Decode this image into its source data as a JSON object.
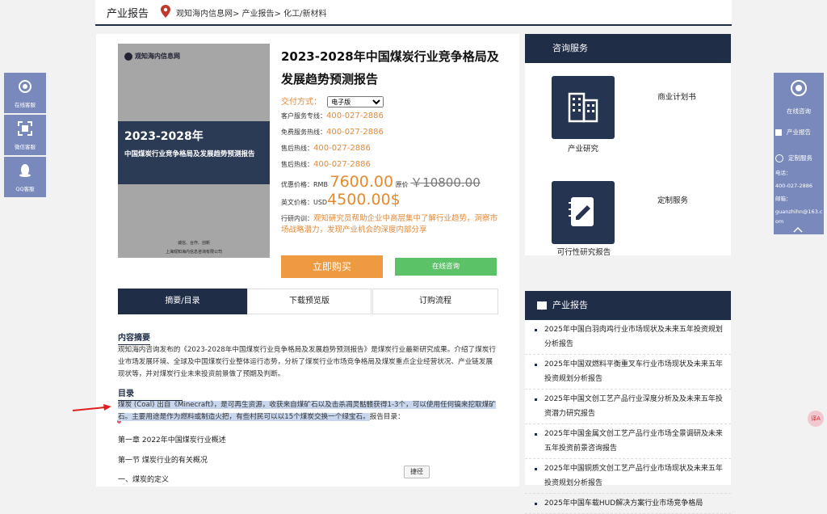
{
  "topbar": {
    "title": "产业报告",
    "breadcrumb": "观知海内信息网> 产业报告> 化工/新材料"
  },
  "cover": {
    "logo": "观知海内信息网",
    "year": "2023-2028年",
    "title": "中国煤炭行业竞争格局及发展趋势预测报告",
    "slogan": "诚信、合作、创新",
    "company": "上海观知海内信息咨询有限公司"
  },
  "product": {
    "title": "2023-2028年中国煤炭行业竞争格局及发展趋势预测报告",
    "delivery_label": "交付方式：",
    "delivery_value": "电子版",
    "hotlines": [
      {
        "label": "客户服务专线：",
        "phone": "400-027-2886"
      },
      {
        "label": "免费服务热线：",
        "phone": "400-027-2886"
      },
      {
        "label": "售后热线：",
        "phone": "400-027-2886"
      },
      {
        "label": "售后热线：",
        "phone": "400-027-2886"
      }
    ],
    "price_label": "优惠价格：",
    "price_currency": "RMB",
    "price_value": "7600.00",
    "orig_label": "原价",
    "orig_value": "￥10800.00",
    "en_label": "英文价格：",
    "en_currency": "USD",
    "en_value": "4500.00$",
    "train_label": "行研内训：",
    "train_text": "观知研究员帮助企业中高层集中了解行业趋势，洞察市场战略潜力，发现产业机会的深度内部分享",
    "buy_label": "立即购买",
    "chat_label": "在线咨询"
  },
  "tabs": [
    "摘要/目录",
    "下载预览版",
    "订购流程"
  ],
  "summary": {
    "heading": "内容摘要",
    "text": "观知海内咨询发布的《2023-2028年中国煤炭行业竞争格局及发展趋势预测报告》是煤炭行业最新研究成果。介绍了煤炭行业市场发展环境、全球及中国煤炭行业整体运行态势，分析了煤炭行业市场竞争格局及煤炭重点企业经营状况、产业链发展现状等，并对煤炭行业未来投资前景做了预期及判断。"
  },
  "toc": {
    "heading": "目录",
    "highlighted": "煤炭 (Coal) 出自《Minecraft》，是可再生资源，收获来自煤矿石以及击杀凋灵骷髅获得1-3个，可以使用任何镐来挖取煤矿石。主要用途是作为燃料或制造火把，有些村民可以以15个煤炭交换一个绿宝石。",
    "tail": "报告目录：",
    "chapter1": "第一章 2022年中国煤炭行业概述",
    "section1": "第一节 煤炭行业的有关概况",
    "item1": "一、煤炭的定义"
  },
  "consult": {
    "header": "咨询服务",
    "items": [
      "产业研究",
      "商业计划书",
      "可行性研究报告",
      "定制服务"
    ]
  },
  "reports": {
    "header": "产业报告",
    "items": [
      "2025年中国白羽肉鸡行业市场现状及未来五年投资规划分析报告",
      "2025年中国双燃料平衡重叉车行业市场现状及未来五年投资规划分析报告",
      "2025年中国文创工艺产品行业深度分析及及未来五年投资潜力研究报告",
      "2025年中国金属文创工艺产品行业市场全景调研及未来五年投资前景咨询报告",
      "2025年中国铜质文创工艺产品行业市场现状及未来五年投资规划分析报告",
      "2025年中国车载HUD解决方案行业市场竞争格局"
    ]
  },
  "left_float": [
    "在线客服",
    "微信客服",
    "QQ客服"
  ],
  "right_float": {
    "online": "在线咨询",
    "report": "产业报告",
    "custom": "定制服务",
    "phone_label": "电话：",
    "phone": "400-027-2886",
    "email_label": "邮箱：",
    "email": "guanzhihn@163.com"
  },
  "screenshot_label": "捷径",
  "translate_label": "译A",
  "colors": {
    "navy": "#1f2d47",
    "orange": "#e58a2e",
    "green": "#5cc268",
    "float": "#7a89bb"
  }
}
